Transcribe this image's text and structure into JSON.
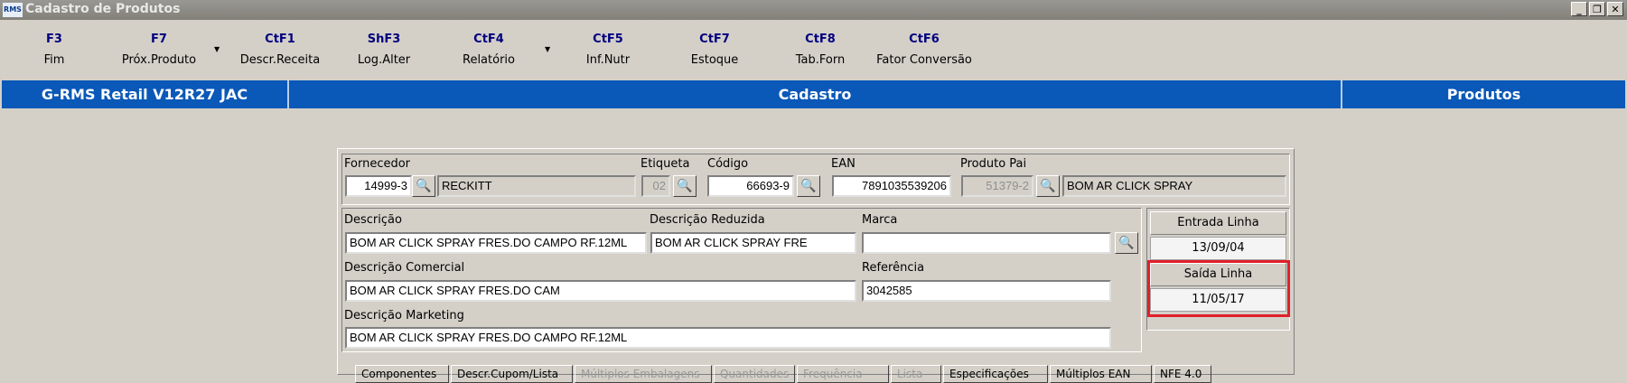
{
  "window": {
    "app_icon": "RMS",
    "title": "Cadastro de Produtos",
    "minimize": "_",
    "restore": "❐",
    "close": "✕"
  },
  "toolbar": [
    {
      "key": "F3",
      "label": "Fim"
    },
    {
      "key": "F7",
      "label": "Próx.Produto"
    },
    {
      "key": "CtF1",
      "label": "Descr.Receita"
    },
    {
      "key": "ShF3",
      "label": "Log.Alter"
    },
    {
      "key": "CtF4",
      "label": "Relatório"
    },
    {
      "key": "CtF5",
      "label": "Inf.Nutr"
    },
    {
      "key": "CtF7",
      "label": "Estoque"
    },
    {
      "key": "CtF8",
      "label": "Tab.Forn"
    },
    {
      "key": "CtF6",
      "label": "Fator Conversão"
    }
  ],
  "dropdown_arrow": "▼",
  "header": {
    "system": "G-RMS Retail V12R27 JAC",
    "module": "Cadastro",
    "section": "Produtos"
  },
  "form": {
    "fornecedor_label": "Fornecedor",
    "fornecedor_code": "14999-3",
    "fornecedor_name": "RECKITT",
    "etiqueta_label": "Etiqueta",
    "etiqueta_value": "02",
    "codigo_label": "Código",
    "codigo_value": "66693-9",
    "ean_label": "EAN",
    "ean_value": "7891035539206",
    "produto_pai_label": "Produto Pai",
    "produto_pai_code": "51379-2",
    "produto_pai_name": "BOM AR CLICK SPRAY",
    "descricao_label": "Descrição",
    "descricao_value": "BOM AR CLICK SPRAY FRES.DO CAMPO RF.12ML",
    "descricao_reduzida_label": "Descrição Reduzida",
    "descricao_reduzida_value": "BOM AR CLICK SPRAY FRE",
    "marca_label": "Marca",
    "marca_value": "",
    "descricao_comercial_label": "Descrição Comercial",
    "descricao_comercial_value": "BOM AR CLICK SPRAY FRES.DO CAM",
    "referencia_label": "Referência",
    "referencia_value": "3042585",
    "descricao_marketing_label": "Descrição Marketing",
    "descricao_marketing_value": "BOM AR CLICK SPRAY FRES.DO CAMPO RF.12ML",
    "entrada_linha_label": "Entrada Linha",
    "entrada_linha_value": "13/09/04",
    "saida_linha_label": "Saída Linha",
    "saida_linha_value": "11/05/17"
  },
  "search_icon": "binoculars-icon",
  "search_glyph": "🔍",
  "tabs": [
    {
      "label": "Componentes",
      "enabled": true
    },
    {
      "label": "Descr.Cupom/Lista",
      "enabled": true
    },
    {
      "label": "Múltiplos Embalagens",
      "enabled": false
    },
    {
      "label": "Quantidades",
      "enabled": false
    },
    {
      "label": "Frequência",
      "enabled": false
    },
    {
      "label": "Lista",
      "enabled": false
    },
    {
      "label": "Especificações",
      "enabled": true
    },
    {
      "label": "Múltiplos EAN",
      "enabled": true
    },
    {
      "label": "NFE 4.0",
      "enabled": true
    }
  ],
  "colors": {
    "header_blue": "#0a58b8",
    "highlight_red": "#e0202a",
    "key_blue": "#000080"
  }
}
